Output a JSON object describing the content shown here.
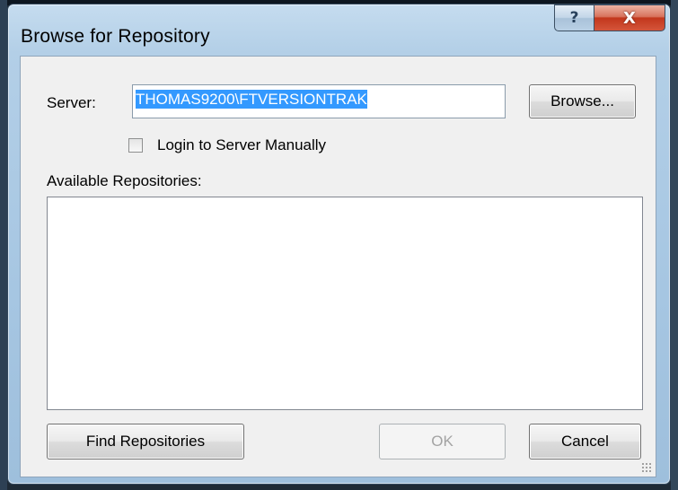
{
  "window": {
    "title": "Browse for Repository",
    "help_glyph": "?",
    "close_glyph": "X"
  },
  "server": {
    "label": "Server:",
    "value": "THOMAS9200\\FTVERSIONTRAK",
    "browse_label": "Browse..."
  },
  "login_manually": {
    "label": "Login to Server Manually",
    "checked": false
  },
  "repositories": {
    "label": "Available Repositories:",
    "items": []
  },
  "buttons": {
    "find_label": "Find Repositories",
    "ok_label": "OK",
    "ok_enabled": false,
    "cancel_label": "Cancel"
  },
  "icons": {
    "help": "help-icon",
    "close": "close-icon",
    "resize": "resize-grip-icon"
  },
  "colors": {
    "selection": "#3399ff",
    "close_button": "#c2371c",
    "title_bar": "#b3cfe7",
    "dialog_face": "#f0f0f0"
  }
}
